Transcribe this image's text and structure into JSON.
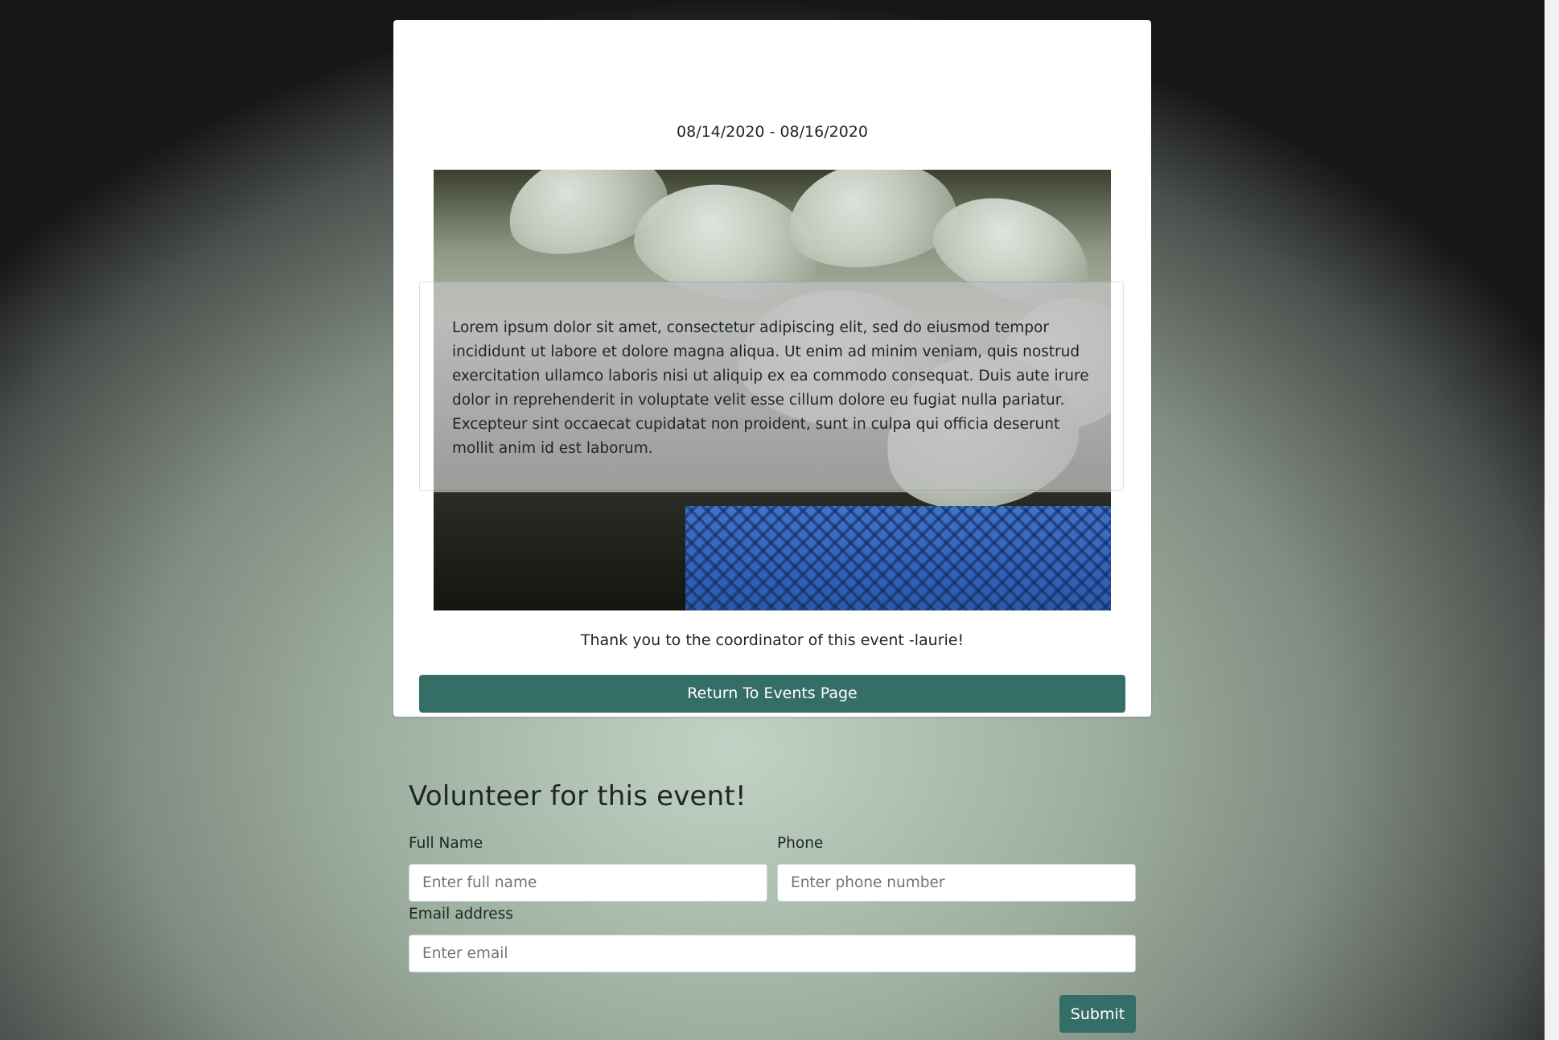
{
  "event": {
    "date_range": "08/14/2020 - 08/16/2020",
    "description": "Lorem ipsum dolor sit amet, consectetur adipiscing elit, sed do eiusmod tempor incididunt ut labore et dolore magna aliqua. Ut enim ad minim veniam, quis nostrud exercitation ullamco laboris nisi ut aliquip ex ea commodo consequat. Duis aute irure dolor in reprehenderit in voluptate velit esse cillum dolore eu fugiat nulla pariatur. Excepteur sint occaecat cupidatat non proident, sunt in culpa qui officia deserunt mollit anim id est laborum.",
    "thanks": "Thank you to the coordinator of this event -laurie!",
    "return_label": "Return To Events Page"
  },
  "volunteer_form": {
    "title": "Volunteer for this event!",
    "full_name": {
      "label": "Full Name",
      "placeholder": "Enter full name"
    },
    "phone": {
      "label": "Phone",
      "placeholder": "Enter phone number"
    },
    "email": {
      "label": "Email address",
      "placeholder": "Enter email"
    },
    "submit_label": "Submit"
  },
  "colors": {
    "accent": "#356e66"
  }
}
